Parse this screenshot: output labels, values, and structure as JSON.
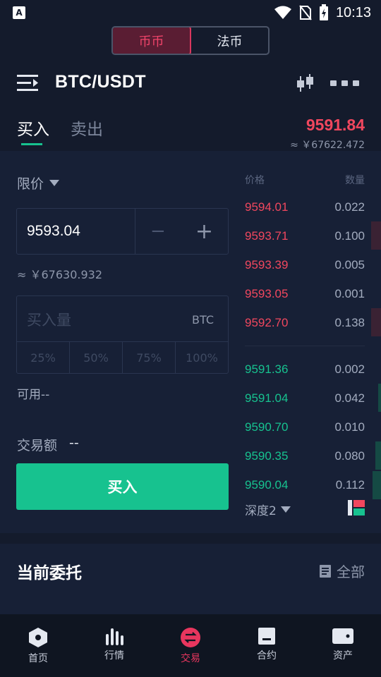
{
  "status_bar": {
    "time": "10:13",
    "app_badge": "A"
  },
  "segment": {
    "items": [
      "币币",
      "法币"
    ],
    "active": 0
  },
  "header": {
    "pair": "BTC/USDT"
  },
  "tabs": {
    "buy": "买入",
    "sell": "卖出"
  },
  "ticker": {
    "last_price": "9591.84",
    "cny": "≈ ￥67622.472"
  },
  "order_form": {
    "order_type": "限价",
    "price": "9593.04",
    "stepper_minus": "−",
    "stepper_plus": "+",
    "price_cny": "≈ ￥67630.932",
    "amount_placeholder": "买入量",
    "amount_unit": "BTC",
    "percents": [
      "25%",
      "50%",
      "75%",
      "100%"
    ],
    "available": "可用--",
    "turnover_label": "交易额",
    "turnover_value": "--",
    "submit_label": "买入"
  },
  "orderbook": {
    "price_header": "价格",
    "qty_header": "数量",
    "asks": [
      {
        "price": "9594.01",
        "qty": "0.022"
      },
      {
        "price": "9593.71",
        "qty": "0.100"
      },
      {
        "price": "9593.39",
        "qty": "0.005"
      },
      {
        "price": "9593.05",
        "qty": "0.001"
      },
      {
        "price": "9592.70",
        "qty": "0.138"
      }
    ],
    "bids": [
      {
        "price": "9591.36",
        "qty": "0.002"
      },
      {
        "price": "9591.04",
        "qty": "0.042"
      },
      {
        "price": "9590.70",
        "qty": "0.010"
      },
      {
        "price": "9590.35",
        "qty": "0.080"
      },
      {
        "price": "9590.04",
        "qty": "0.112"
      }
    ],
    "depth_label": "深度2"
  },
  "current_orders": {
    "title": "当前委托",
    "all_label": "全部"
  },
  "bottom_nav": [
    {
      "label": "首页",
      "icon": "home-hexagon-icon"
    },
    {
      "label": "行情",
      "icon": "market-bars-icon"
    },
    {
      "label": "交易",
      "icon": "trade-exchange-icon"
    },
    {
      "label": "合约",
      "icon": "contract-icon"
    },
    {
      "label": "资产",
      "icon": "wallet-icon"
    }
  ],
  "colors": {
    "buy_green": "#17c28f",
    "sell_red": "#f0475e",
    "accent_pink": "#e8365e",
    "background": "#141b2c"
  }
}
